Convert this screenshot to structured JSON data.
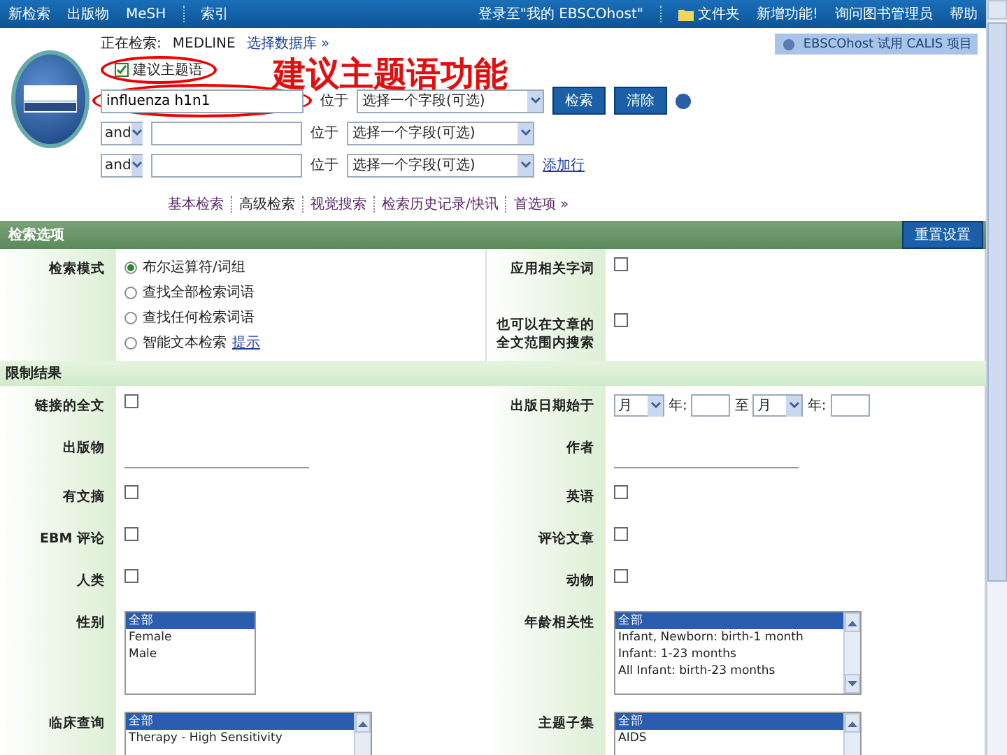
{
  "top_nav": {
    "left": [
      {
        "label": "新检索"
      },
      {
        "label": "出版物"
      },
      {
        "label": "MeSH"
      },
      {
        "label": "索引"
      }
    ],
    "right": [
      {
        "label": "登录至\"我的 EBSCOhost\"",
        "kind": "link"
      },
      {
        "label": "文件夹",
        "kind": "folder"
      },
      {
        "label": "新增功能!",
        "kind": "link"
      },
      {
        "label": "询问图书管理员",
        "kind": "link"
      },
      {
        "label": "帮助",
        "kind": "link"
      }
    ]
  },
  "search": {
    "searching_label": "正在检索:",
    "database": "MEDLINE",
    "choose_db": "选择数据库 »",
    "suggest": {
      "label": "建议主题语",
      "checked": true,
      "highlighted": true
    },
    "annotation": "建议主题语功能",
    "partner_banner": "EBSCOhost 试用 CALIS 项目",
    "rows": [
      {
        "operator": null,
        "value": "influenza h1n1",
        "highlighted": true,
        "in_label": "位于",
        "field": "选择一个字段(可选)"
      },
      {
        "operator": "and",
        "value": null,
        "highlighted": false,
        "in_label": "位于",
        "field": "选择一个字段(可选)"
      },
      {
        "operator": "and",
        "value": null,
        "highlighted": false,
        "in_label": "位于",
        "field": "选择一个字段(可选)"
      }
    ],
    "search_button": "检索",
    "clear_button": "清除",
    "add_row": "添加行",
    "modes": [
      {
        "label": "基本检索",
        "selected": false
      },
      {
        "label": "高级检索",
        "selected": true
      },
      {
        "label": "视觉搜索",
        "selected": false
      },
      {
        "label": "检索历史记录/快讯",
        "selected": false
      },
      {
        "label": "首选项 »",
        "selected": false
      }
    ]
  },
  "options": {
    "title": "检索选项",
    "reset_button": "重置设置",
    "mode_label": "检索模式",
    "radios": [
      {
        "label": "布尔运算符/词组",
        "selected": true
      },
      {
        "label": "查找全部检索词语",
        "selected": false
      },
      {
        "label": "查找任何检索词语",
        "selected": false
      },
      {
        "label": "智能文本检索",
        "selected": false,
        "hint": "提示"
      }
    ],
    "checks": [
      {
        "label": "应用相关字词",
        "checked": false
      },
      {
        "label": "也可以在文章的全文范围内搜索",
        "checked": false
      }
    ]
  },
  "limits": {
    "title": "限制结果",
    "items": [
      {
        "kind": "checkbox",
        "label": "链接的全文",
        "checked": false
      },
      {
        "kind": "date",
        "label": "出版日期始于",
        "from_month": "月",
        "year_label": "年:",
        "to_label": "至",
        "to_month": "月",
        "to_year_label": "年:"
      },
      {
        "kind": "input",
        "label": "出版物"
      },
      {
        "kind": "input",
        "label": "作者"
      },
      {
        "kind": "checkbox",
        "label": "有文摘",
        "checked": false
      },
      {
        "kind": "checkbox",
        "label": "英语",
        "checked": false
      },
      {
        "kind": "checkbox",
        "label": "EBM 评论",
        "checked": false
      },
      {
        "kind": "checkbox",
        "label": "评论文章",
        "checked": false
      },
      {
        "kind": "checkbox",
        "label": "人类",
        "checked": false
      },
      {
        "kind": "checkbox",
        "label": "动物",
        "checked": false
      },
      {
        "kind": "list",
        "label": "性别",
        "scroll": false,
        "options": [
          {
            "label": "全部",
            "selected": true
          },
          {
            "label": "Female",
            "selected": false
          },
          {
            "label": "Male",
            "selected": false
          }
        ]
      },
      {
        "kind": "list",
        "label": "年龄相关性",
        "scroll": true,
        "options": [
          {
            "label": "全部",
            "selected": true
          },
          {
            "label": "Infant, Newborn: birth-1 month",
            "selected": false
          },
          {
            "label": "Infant: 1-23 months",
            "selected": false
          },
          {
            "label": "All Infant: birth-23 months",
            "selected": false
          }
        ]
      },
      {
        "kind": "list",
        "label": "临床查询",
        "scroll": true,
        "options": [
          {
            "label": "全部",
            "selected": true
          },
          {
            "label": "Therapy - High Sensitivity",
            "selected": false
          }
        ]
      },
      {
        "kind": "list",
        "label": "主题子集",
        "scroll": true,
        "options": [
          {
            "label": "全部",
            "selected": true
          },
          {
            "label": "AIDS",
            "selected": false
          }
        ]
      }
    ]
  }
}
